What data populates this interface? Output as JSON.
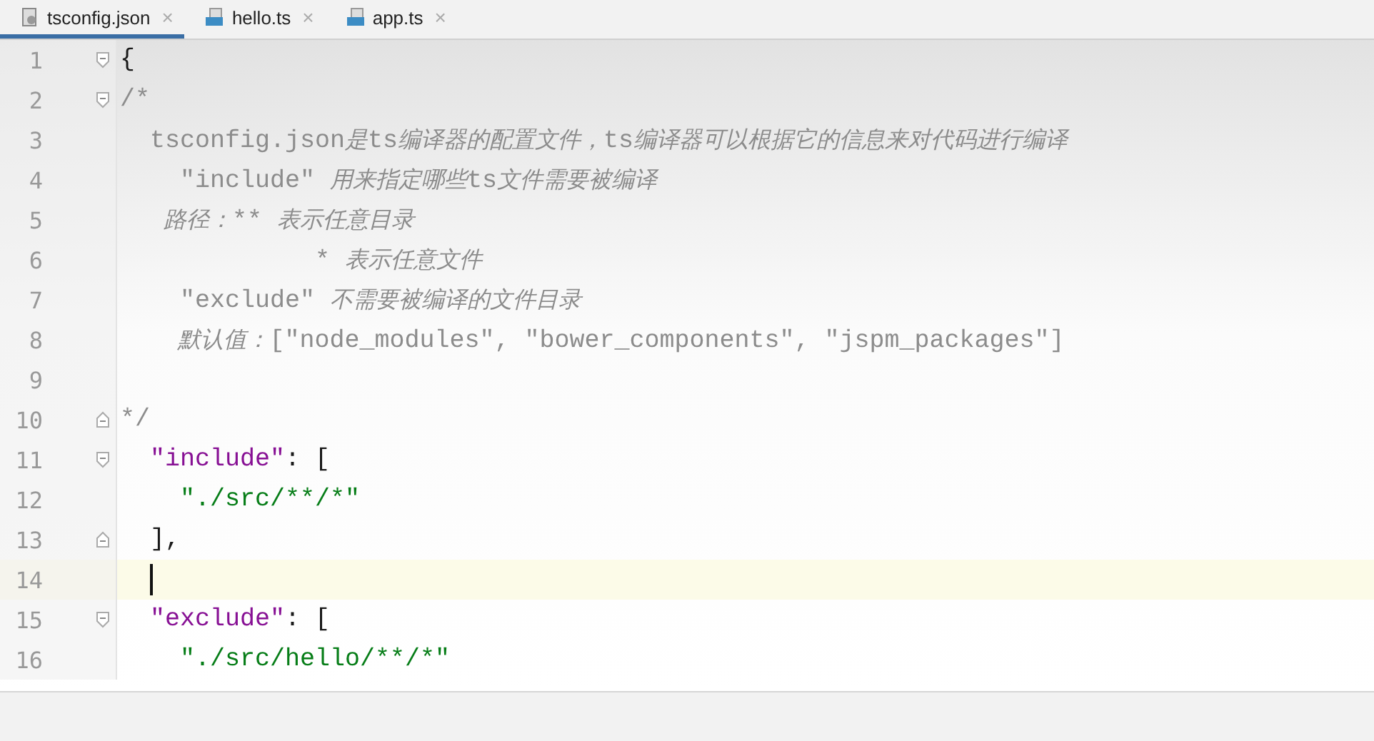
{
  "tabs": [
    {
      "label": "tsconfig.json",
      "kind": "json",
      "close": "×",
      "selected": true
    },
    {
      "label": "hello.ts",
      "kind": "ts",
      "close": "×",
      "selected": false
    },
    {
      "label": "app.ts",
      "kind": "ts",
      "close": "×",
      "selected": false
    }
  ],
  "lines": [
    {
      "number": "1",
      "kind": "start",
      "current": false,
      "parts": [
        {
          "kind": "punct",
          "text": "{"
        }
      ]
    },
    {
      "number": "2",
      "kind": "start",
      "current": false,
      "parts": [
        {
          "kind": "comment",
          "text": "/*"
        }
      ]
    },
    {
      "number": "3",
      "kind": "plain",
      "current": false,
      "parts": [
        {
          "kind": "comment",
          "text": "  tsconfig.json"
        },
        {
          "kind": "note",
          "text": "是"
        },
        {
          "kind": "comment",
          "text": "ts"
        },
        {
          "kind": "note",
          "text": "编译器的配置文件，"
        },
        {
          "kind": "comment",
          "text": "ts"
        },
        {
          "kind": "note",
          "text": "编译器可以根据它的信息来对代码进行编译"
        }
      ]
    },
    {
      "number": "4",
      "kind": "plain",
      "current": false,
      "parts": [
        {
          "kind": "comment",
          "text": "    \"include\" "
        },
        {
          "kind": "note",
          "text": "用来指定哪些"
        },
        {
          "kind": "comment",
          "text": "ts"
        },
        {
          "kind": "note",
          "text": "文件需要被编译"
        }
      ]
    },
    {
      "number": "5",
      "kind": "plain",
      "current": false,
      "parts": [
        {
          "kind": "note",
          "text": "      路径："
        },
        {
          "kind": "comment",
          "text": "** "
        },
        {
          "kind": "note",
          "text": "表示任意目录"
        }
      ]
    },
    {
      "number": "6",
      "kind": "plain",
      "current": false,
      "parts": [
        {
          "kind": "comment",
          "text": "             * "
        },
        {
          "kind": "note",
          "text": "表示任意文件"
        }
      ]
    },
    {
      "number": "7",
      "kind": "plain",
      "current": false,
      "parts": [
        {
          "kind": "comment",
          "text": "    \"exclude\" "
        },
        {
          "kind": "note",
          "text": "不需要被编译的文件目录"
        }
      ]
    },
    {
      "number": "8",
      "kind": "plain",
      "current": false,
      "parts": [
        {
          "kind": "note",
          "text": "        默认值："
        },
        {
          "kind": "comment",
          "text": "[\"node_modules\", \"bower_components\", \"jspm_packages\"]"
        }
      ]
    },
    {
      "number": "9",
      "kind": "plain",
      "current": false
    },
    {
      "number": "10",
      "kind": "end",
      "current": false,
      "parts": [
        {
          "kind": "comment",
          "text": "*/"
        }
      ]
    },
    {
      "number": "11",
      "kind": "start",
      "current": false,
      "parts": [
        {
          "kind": "key",
          "text": "  \"include\""
        },
        {
          "kind": "punct",
          "text": ": ["
        }
      ]
    },
    {
      "number": "12",
      "kind": "plain",
      "current": false,
      "parts": [
        {
          "kind": "string",
          "text": "    \"./src/**/*\""
        }
      ]
    },
    {
      "number": "13",
      "kind": "end",
      "current": false,
      "parts": [
        {
          "kind": "punct",
          "text": "  ],"
        }
      ]
    },
    {
      "number": "14",
      "kind": "plain",
      "current": true
    },
    {
      "number": "15",
      "kind": "start",
      "current": false,
      "parts": [
        {
          "kind": "key",
          "text": "  \"exclude\""
        },
        {
          "kind": "punct",
          "text": ": ["
        }
      ]
    },
    {
      "number": "16",
      "kind": "plain",
      "current": false,
      "parts": [
        {
          "kind": "string",
          "text": "    \"./src/hello/**/*\""
        }
      ]
    }
  ]
}
